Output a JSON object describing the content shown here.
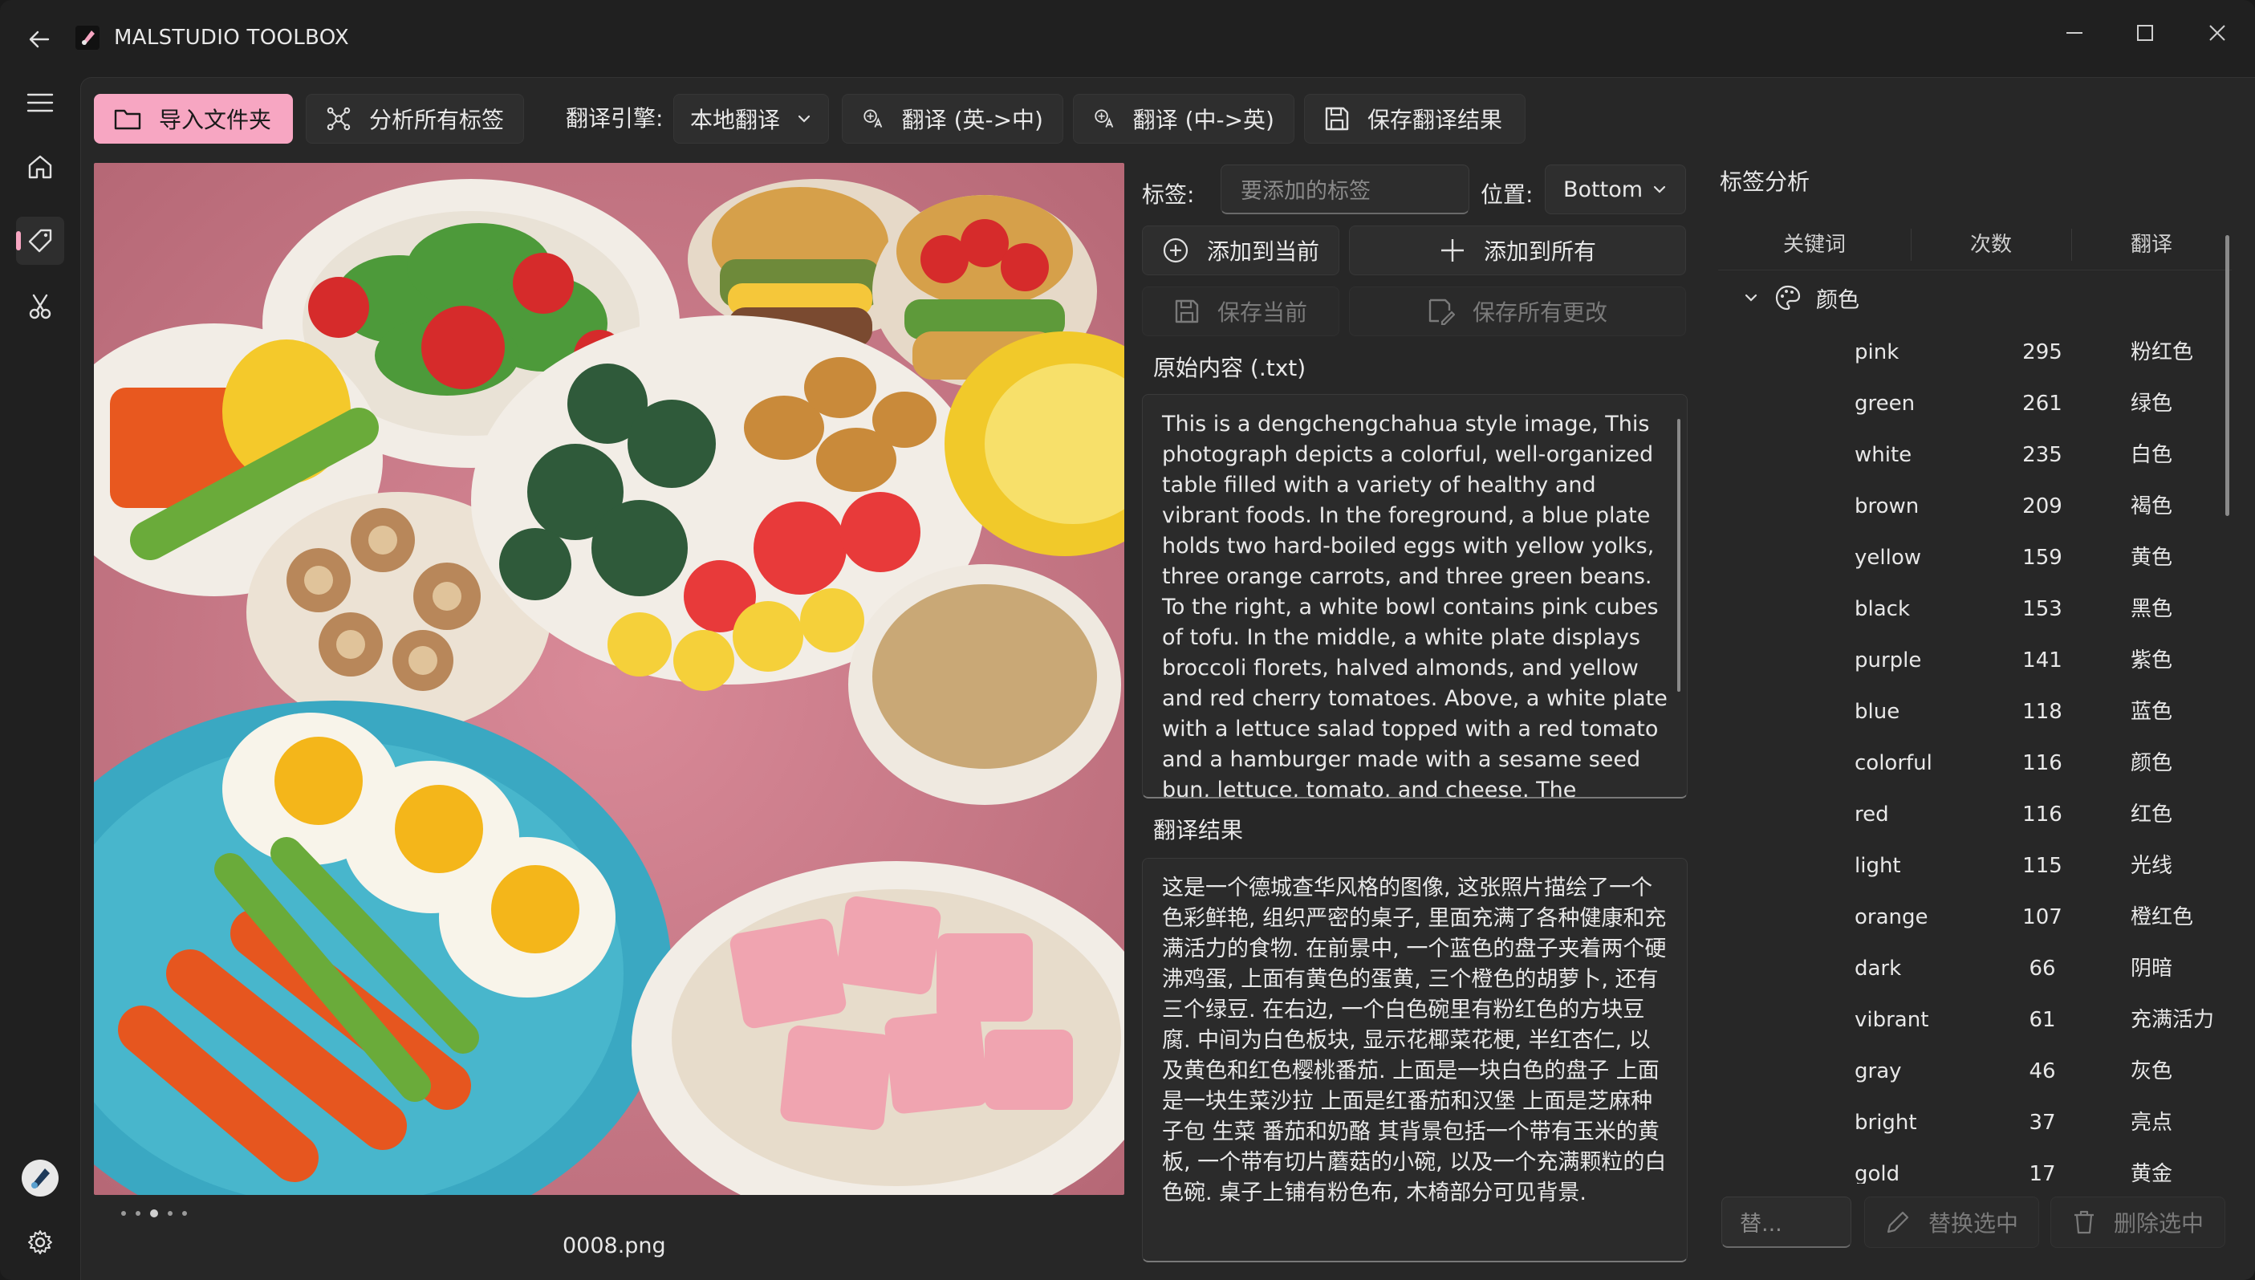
{
  "app": {
    "title": "MALSTUDIO TOOLBOX"
  },
  "toolbar": {
    "import_folder": "导入文件夹",
    "analyze_tags": "分析所有标签",
    "engine_label": "翻译引擎:",
    "engine_value": "本地翻译",
    "translate_en_zh": "翻译 (英->中)",
    "translate_zh_en": "翻译 (中->英)",
    "save_translation": "保存翻译结果"
  },
  "preview": {
    "filename": "0008.png",
    "page_dots": 5,
    "active_dot": 2
  },
  "tag_editor": {
    "tag_label": "标签:",
    "tag_placeholder": "要添加的标签",
    "position_label": "位置:",
    "position_value": "Bottom",
    "add_current": "添加到当前",
    "add_all": "添加到所有",
    "save_current": "保存当前",
    "save_all": "保存所有更改",
    "original_label": "原始内容 (.txt)",
    "original_text": "This is a dengchengchahua style image, This photograph depicts a colorful, well-organized table filled with a variety of healthy and vibrant foods. In the foreground, a blue plate holds two hard-boiled eggs with yellow yolks, three orange carrots, and three green beans. To the right, a white bowl contains pink cubes of tofu. In the middle, a white plate displays broccoli florets, halved almonds, and yellow and red cherry tomatoes. Above, a white plate with a lettuce salad topped with a red tomato and a hamburger made with a sesame seed bun, lettuce, tomato, and cheese. The background includes a yellow plate with corn, a small bowl with",
    "translation_label": "翻译结果",
    "translation_text": "这是一个德城查华风格的图像, 这张照片描绘了一个色彩鲜艳, 组织严密的桌子, 里面充满了各种健康和充满活力的食物. 在前景中, 一个蓝色的盘子夹着两个硬沸鸡蛋, 上面有黄色的蛋黄, 三个橙色的胡萝卜, 还有三个绿豆. 在右边, 一个白色碗里有粉红色的方块豆腐. 中间为白色板块, 显示花椰菜花梗, 半红杏仁, 以及黄色和红色樱桃番茄. 上面是一块白色的盘子 上面是一块生菜沙拉 上面是红番茄和汉堡 上面是芝麻种子包 生菜 番茄和奶酪 其背景包括一个带有玉米的黄板, 一个带有切片蘑菇的小碗, 以及一个充满颗粒的白色碗. 桌子上铺有粉色布, 木椅部分可见背景."
  },
  "tag_analysis": {
    "title": "标签分析",
    "columns": [
      "关键词",
      "次数",
      "翻译"
    ],
    "group": "颜色",
    "rows": [
      {
        "keyword": "pink",
        "count": "295",
        "translation": "粉红色"
      },
      {
        "keyword": "green",
        "count": "261",
        "translation": "绿色"
      },
      {
        "keyword": "white",
        "count": "235",
        "translation": "白色"
      },
      {
        "keyword": "brown",
        "count": "209",
        "translation": "褐色"
      },
      {
        "keyword": "yellow",
        "count": "159",
        "translation": "黄色"
      },
      {
        "keyword": "black",
        "count": "153",
        "translation": "黑色"
      },
      {
        "keyword": "purple",
        "count": "141",
        "translation": "紫色"
      },
      {
        "keyword": "blue",
        "count": "118",
        "translation": "蓝色"
      },
      {
        "keyword": "colorful",
        "count": "116",
        "translation": "颜色"
      },
      {
        "keyword": "red",
        "count": "116",
        "translation": "红色"
      },
      {
        "keyword": "light",
        "count": "115",
        "translation": "光线"
      },
      {
        "keyword": "orange",
        "count": "107",
        "translation": "橙红色"
      },
      {
        "keyword": "dark",
        "count": "66",
        "translation": "阴暗"
      },
      {
        "keyword": "vibrant",
        "count": "61",
        "translation": "充满活力"
      },
      {
        "keyword": "gray",
        "count": "46",
        "translation": "灰色"
      },
      {
        "keyword": "bright",
        "count": "37",
        "translation": "亮点"
      },
      {
        "keyword": "gold",
        "count": "17",
        "translation": "黄金"
      }
    ],
    "replace_placeholder": "替...",
    "replace_selected": "替换选中",
    "delete_selected": "删除选中"
  },
  "colors": {
    "accent": "#f7a6c2",
    "background": "#202020",
    "panel": "#272727"
  }
}
